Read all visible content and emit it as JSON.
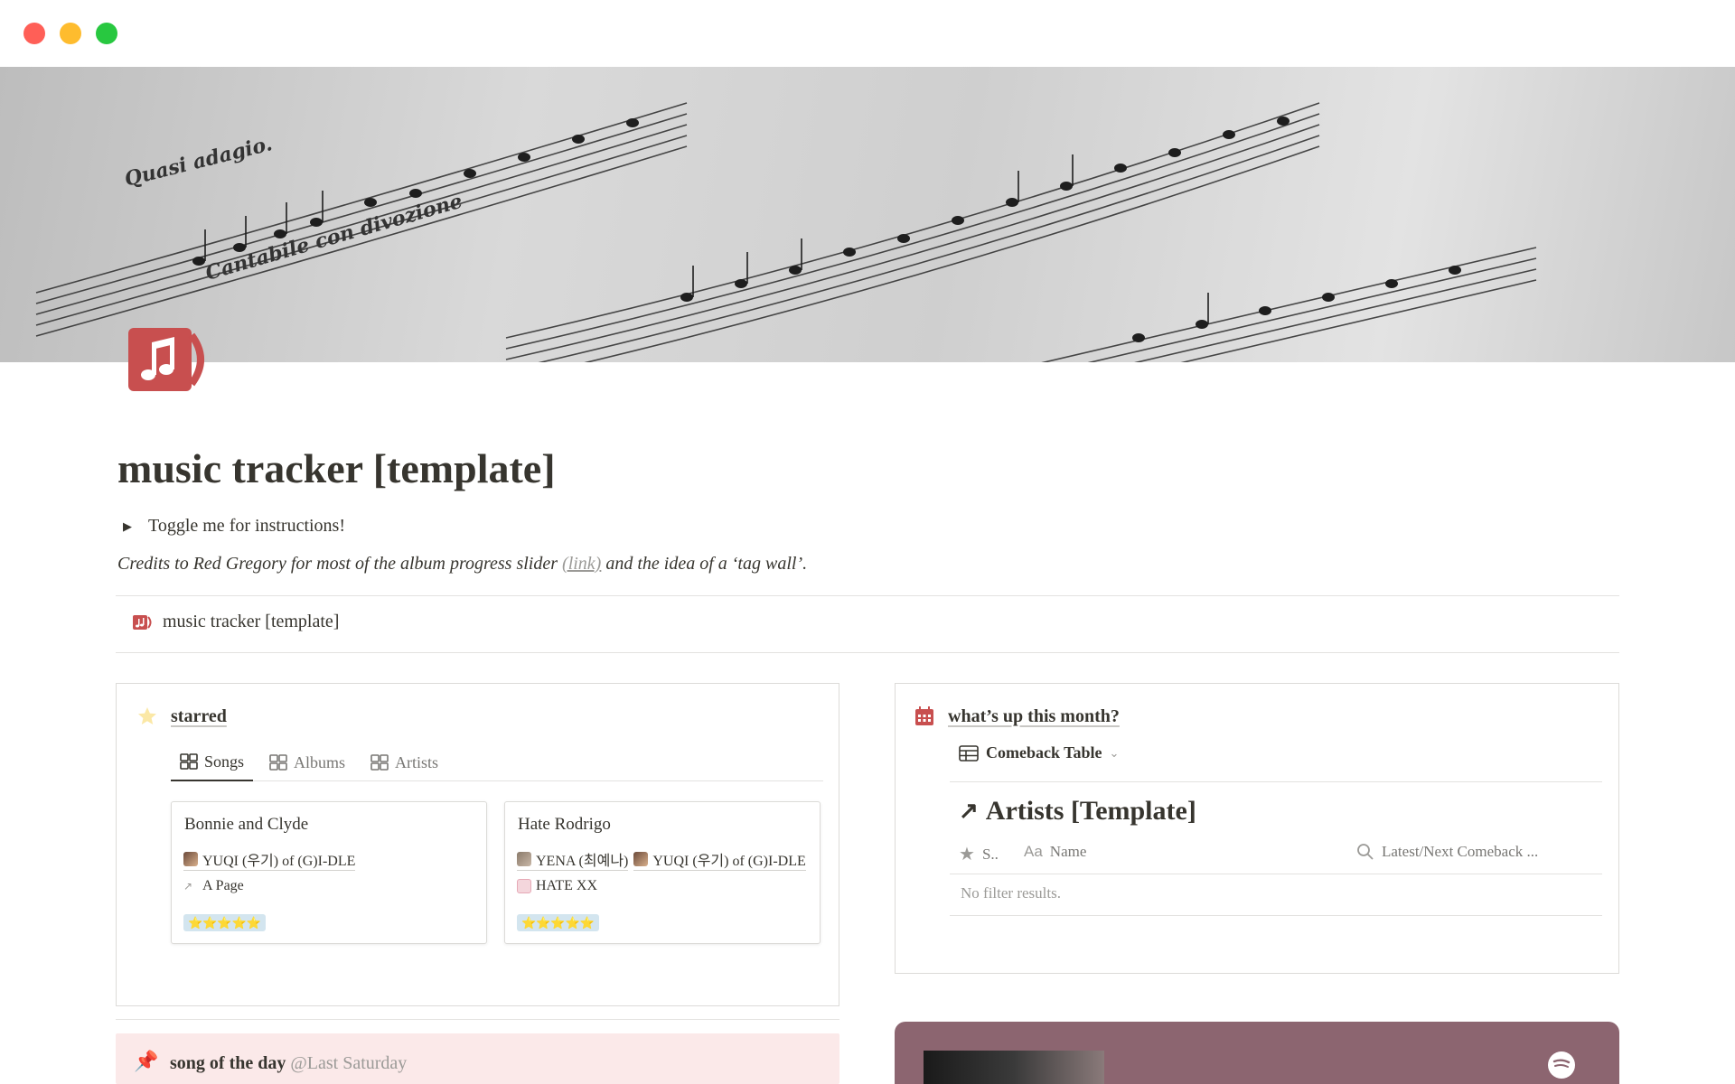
{
  "window": {
    "buttons": [
      "close",
      "minimize",
      "maximize"
    ]
  },
  "cover": {
    "description_icon": "sheet-music-cover"
  },
  "page": {
    "title": "music tracker [template]",
    "toggle_label": "Toggle me for instructions!",
    "credits_pre": "Credits to Red Gregory for most of the album progress slider ",
    "credits_link": "(link)",
    "credits_post": " and the idea of a ‘tag wall’.",
    "linked_page_label": "music tracker [template]"
  },
  "starred": {
    "title": "starred",
    "tabs": [
      {
        "label": "Songs",
        "active": true
      },
      {
        "label": "Albums",
        "active": false
      },
      {
        "label": "Artists",
        "active": false
      }
    ],
    "cards": [
      {
        "title": "Bonnie and Clyde",
        "artists": [
          "YUQI (우기) of (G)I-DLE"
        ],
        "album": "A Page",
        "rating": "⭐⭐⭐⭐⭐"
      },
      {
        "title": "Hate Rodrigo",
        "artists": [
          "YENA (최예나)",
          "YUQI (우기) of (G)I-DLE"
        ],
        "album": "HATE XX",
        "rating": "⭐⭐⭐⭐⭐"
      }
    ]
  },
  "month": {
    "title": "what’s up this month?",
    "view_label": "Comeback Table",
    "db_title": "Artists [Template]",
    "columns": [
      "S..",
      "Name",
      "Latest/Next Comeback ..."
    ],
    "empty_text": "No filter results."
  },
  "song_of_day": {
    "title": "song of the day",
    "date": "@Last Saturday"
  },
  "colors": {
    "accent_red": "#c84f4f",
    "sotd_bg": "#fbe9e9",
    "spotify_bg": "#8c6570",
    "tag_blue": "#d3e5ef"
  }
}
